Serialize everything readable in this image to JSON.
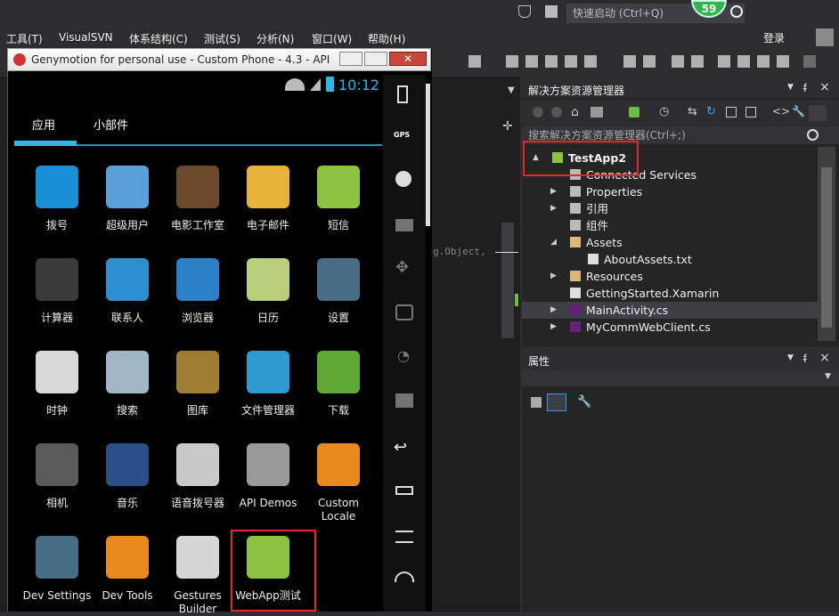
{
  "topbar": {
    "quick_launch_placeholder": "快速启动 (Ctrl+Q)",
    "notification_count": "59"
  },
  "menu": [
    "工具(T)",
    "VisualSVN",
    "体系结构(C)",
    "测试(S)",
    "分析(N)",
    "窗口(W)",
    "帮助(H)"
  ],
  "account": {
    "login_label": "登录"
  },
  "solution_explorer": {
    "title": "解决方案资源管理器",
    "search_placeholder": "搜索解决方案资源管理器(Ctrl+;)",
    "tree": [
      {
        "label": "TestApp2",
        "indent": 0,
        "expander": "▲",
        "icon": "android-project-icon"
      },
      {
        "label": "Connected Services",
        "indent": 1,
        "expander": "",
        "icon": "connected-services-icon"
      },
      {
        "label": "Properties",
        "indent": 1,
        "expander": "▶",
        "icon": "wrench-icon"
      },
      {
        "label": "引用",
        "indent": 1,
        "expander": "▶",
        "icon": "references-icon"
      },
      {
        "label": "组件",
        "indent": 1,
        "expander": "",
        "icon": "components-icon"
      },
      {
        "label": "Assets",
        "indent": 1,
        "expander": "◢",
        "icon": "folder-icon"
      },
      {
        "label": "AboutAssets.txt",
        "indent": 2,
        "expander": "",
        "icon": "text-file-icon"
      },
      {
        "label": "Resources",
        "indent": 1,
        "expander": "▶",
        "icon": "folder-icon"
      },
      {
        "label": "GettingStarted.Xamarin",
        "indent": 1,
        "expander": "",
        "icon": "file-icon"
      },
      {
        "label": "MainActivity.cs",
        "indent": 1,
        "expander": "▶",
        "icon": "csharp-file-icon"
      },
      {
        "label": "MyCommWebClient.cs",
        "indent": 1,
        "expander": "▶",
        "icon": "csharp-file-icon"
      }
    ]
  },
  "properties": {
    "title": "属性"
  },
  "editor": {
    "code_fragment": "g.Object, "
  },
  "emulator": {
    "title": "Genymotion for personal use - Custom Phone - 4.3 - API ...",
    "time": "10:12",
    "tabs": [
      "应用",
      "小部件"
    ],
    "sidebar_labels": {
      "gps": "GPS"
    },
    "apps": [
      {
        "label": "拨号",
        "color": "#1a8fd6"
      },
      {
        "label": "超级用户",
        "color": "#5aa0d8"
      },
      {
        "label": "电影工作室",
        "color": "#6b4a2c"
      },
      {
        "label": "电子邮件",
        "color": "#e7b23a"
      },
      {
        "label": "短信",
        "color": "#8cc43f"
      },
      {
        "label": "计算器",
        "color": "#3a3a3a"
      },
      {
        "label": "联系人",
        "color": "#2f8ed0"
      },
      {
        "label": "浏览器",
        "color": "#2a7fc7"
      },
      {
        "label": "日历",
        "color": "#b9cf7e"
      },
      {
        "label": "设置",
        "color": "#4a6d86"
      },
      {
        "label": "时钟",
        "color": "#d9d9d9"
      },
      {
        "label": "搜索",
        "color": "#9fb7c6"
      },
      {
        "label": "图库",
        "color": "#a07c33"
      },
      {
        "label": "文件管理器",
        "color": "#2f9ad2"
      },
      {
        "label": "下载",
        "color": "#5fa936"
      },
      {
        "label": "相机",
        "color": "#5a5a5a"
      },
      {
        "label": "音乐",
        "color": "#2c4e86"
      },
      {
        "label": "语音拨号器",
        "color": "#c9c9c9"
      },
      {
        "label": "API Demos",
        "color": "#9a9a9a"
      },
      {
        "label": "Custom Locale",
        "color": "#e98a1f"
      },
      {
        "label": "Dev Settings",
        "color": "#4a6d86"
      },
      {
        "label": "Dev Tools",
        "color": "#e98a1f"
      },
      {
        "label": "Gestures Builder",
        "color": "#d6d6d6"
      },
      {
        "label": "WebApp测试",
        "color": "#8cc43f"
      }
    ]
  },
  "colors": {
    "accent": "#33b5e5",
    "highlight_box": "#e8232b",
    "vs_background": "#2d2d30"
  }
}
